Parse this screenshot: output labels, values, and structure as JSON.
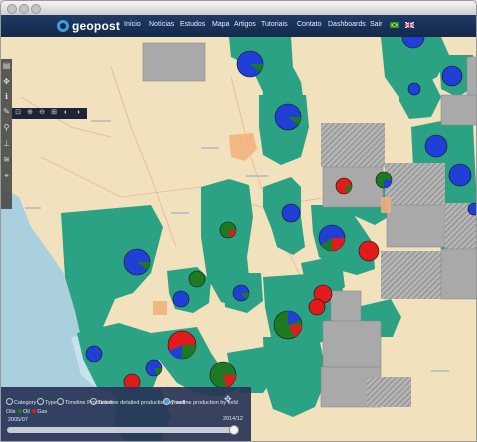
{
  "app": {
    "logo_text": "geopost"
  },
  "nav": {
    "items": [
      "Início",
      "Notícias",
      "Estudos",
      "Mapa",
      "Artigos",
      "Tutoriais",
      "Contato",
      "Dashboards",
      "Sair"
    ],
    "flags": [
      "brazil-flag-icon",
      "uk-flag-icon"
    ]
  },
  "toolbar": {
    "tools": [
      "layers-icon",
      "pan-icon",
      "info-icon",
      "edit-icon",
      "search-icon",
      "measure-icon",
      "chart-icon",
      "location-icon"
    ],
    "zoom_buttons": [
      "zoom-extent-icon",
      "zoom-in-icon",
      "zoom-out-icon",
      "zoom-box-icon",
      "zoom-prev-icon",
      "zoom-next-icon"
    ]
  },
  "legend": {
    "items": [
      "Category",
      "Type",
      "Timeline Production",
      "Timeline detailed production by well",
      "Timeline production by field"
    ],
    "sub_label": "Oils",
    "sub_items": [
      "Oil",
      "Gas"
    ],
    "year_start": "2005/07",
    "year_end": "2014/12",
    "slider_position": 0.98
  },
  "colors": {
    "navbar": "#14294a",
    "field_polygon": "#2aa283",
    "block_gray": "#a9a9a9",
    "oil_red": "#e31a1c",
    "gas_blue": "#1f3fd6",
    "field_green": "#1e7a22"
  }
}
